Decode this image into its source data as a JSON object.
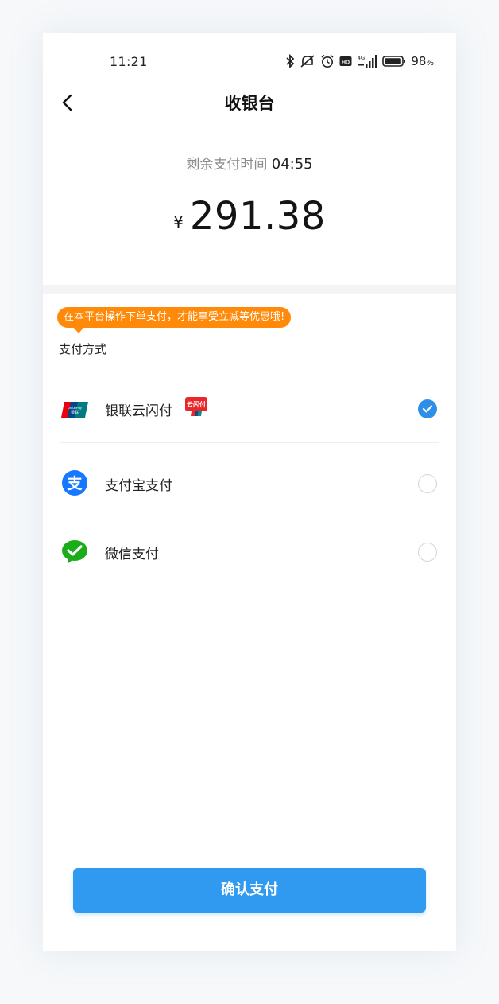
{
  "status_bar": {
    "time": "11:21",
    "network": "4G",
    "battery_percent": "98",
    "battery_unit": "%",
    "icons": [
      "bluetooth-icon",
      "mute-icon",
      "alarm-icon",
      "hd-icon",
      "signal-icon",
      "battery-icon"
    ]
  },
  "nav": {
    "title": "收银台",
    "back_icon": "chevron-left-icon"
  },
  "payment": {
    "countdown_label": "剩余支付时间",
    "countdown_value": "04:55",
    "currency_symbol": "¥",
    "amount": "291.38"
  },
  "promo": {
    "text": "在本平台操作下单支付，才能享受立减等优惠哦!"
  },
  "methods_section": {
    "title": "支付方式",
    "items": [
      {
        "label": "银联云闪付",
        "icon": "unionpay-icon",
        "badge": "云闪付",
        "selected": true
      },
      {
        "label": "支付宝支付",
        "icon": "alipay-icon",
        "selected": false
      },
      {
        "label": "微信支付",
        "icon": "wechat-pay-icon",
        "selected": false
      }
    ]
  },
  "actions": {
    "confirm_label": "确认支付"
  },
  "colors": {
    "primary": "#2f9af0",
    "promo": "#ff8a0a",
    "check": "#2f8fe8",
    "alipay": "#1677ff",
    "wechat": "#1aad19",
    "unionpay_red": "#e60012"
  }
}
